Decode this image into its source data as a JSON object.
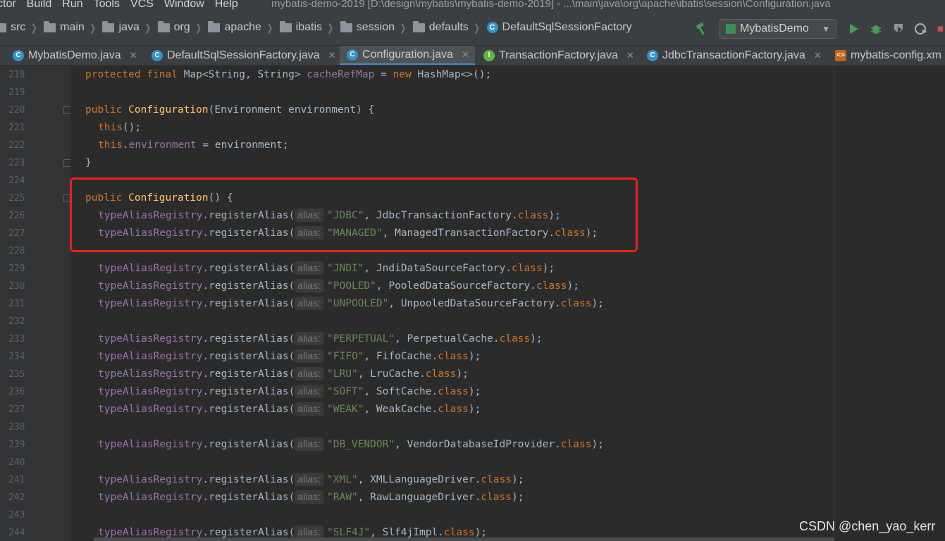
{
  "menu": {
    "items": [
      "ctor",
      "Build",
      "Run",
      "Tools",
      "VCS",
      "Window",
      "Help"
    ],
    "window_title": "mybatis-demo-2019 [D:\\design\\mybatis\\mybatis-demo-2019] - ...\\main\\java\\org\\apache\\ibatis\\session\\Configuration.java"
  },
  "breadcrumb": {
    "items": [
      "src",
      "main",
      "java",
      "org",
      "apache",
      "ibatis",
      "session",
      "defaults"
    ],
    "class_name": "DefaultSqlSessionFactory",
    "class_icon": "class-icon"
  },
  "toolbar": {
    "run_config": "MybatisDemo",
    "icons": [
      "hammer-icon",
      "run-icon",
      "debug-icon",
      "coverage-icon",
      "profile-icon",
      "stop-icon"
    ]
  },
  "tabs": [
    {
      "label": "MybatisDemo.java",
      "icon": "class-icon",
      "active": false
    },
    {
      "label": "DefaultSqlSessionFactory.java",
      "icon": "class-icon",
      "active": false
    },
    {
      "label": "Configuration.java",
      "icon": "class-icon",
      "active": true
    },
    {
      "label": "TransactionFactory.java",
      "icon": "interface-icon",
      "active": false
    },
    {
      "label": "JdbcTransactionFactory.java",
      "icon": "class-icon",
      "active": false
    },
    {
      "label": "mybatis-config.xm",
      "icon": "xml-icon",
      "active": false
    }
  ],
  "editor": {
    "line_numbers": [
      "218",
      "219",
      "220",
      "221",
      "222",
      "223",
      "224",
      "225",
      "226",
      "227",
      "228",
      "229",
      "230",
      "231",
      "232",
      "233",
      "234",
      "235",
      "236",
      "237",
      "238",
      "239",
      "240",
      "241",
      "242",
      "243",
      "244"
    ],
    "param_hint": "alias:",
    "lines": {
      "l218": [
        "protected",
        " ",
        "final",
        " Map<String, String> ",
        "cacheRefMap",
        " = ",
        "new",
        " HashMap<>();"
      ],
      "l220": [
        "public",
        " ",
        "Configuration",
        "(Environment environment) {"
      ],
      "l221": [
        "this",
        "();"
      ],
      "l222": [
        "this",
        ".",
        "environment",
        " = environment;"
      ],
      "l223": "}",
      "l225": [
        "public",
        " ",
        "Configuration",
        "() {"
      ]
    },
    "alias_calls": [
      {
        "line": "226",
        "target": "typeAliasRegistry",
        "method": ".registerAlias(",
        "alias": "\"JDBC\"",
        "cls": ", JdbcTransactionFactory.",
        "suffix": "class",
        "end": ");"
      },
      {
        "line": "227",
        "target": "typeAliasRegistry",
        "method": ".registerAlias(",
        "alias": "\"MANAGED\"",
        "cls": ", ManagedTransactionFactory.",
        "suffix": "class",
        "end": ");"
      },
      {
        "line": "229",
        "target": "typeAliasRegistry",
        "method": ".registerAlias(",
        "alias": "\"JNDI\"",
        "cls": ", JndiDataSourceFactory.",
        "suffix": "class",
        "end": ");"
      },
      {
        "line": "230",
        "target": "typeAliasRegistry",
        "method": ".registerAlias(",
        "alias": "\"POOLED\"",
        "cls": ", PooledDataSourceFactory.",
        "suffix": "class",
        "end": ");"
      },
      {
        "line": "231",
        "target": "typeAliasRegistry",
        "method": ".registerAlias(",
        "alias": "\"UNPOOLED\"",
        "cls": ", UnpooledDataSourceFactory.",
        "suffix": "class",
        "end": ");"
      },
      {
        "line": "233",
        "target": "typeAliasRegistry",
        "method": ".registerAlias(",
        "alias": "\"PERPETUAL\"",
        "cls": ", PerpetualCache.",
        "suffix": "class",
        "end": ");"
      },
      {
        "line": "234",
        "target": "typeAliasRegistry",
        "method": ".registerAlias(",
        "alias": "\"FIFO\"",
        "cls": ", FifoCache.",
        "suffix": "class",
        "end": ");"
      },
      {
        "line": "235",
        "target": "typeAliasRegistry",
        "method": ".registerAlias(",
        "alias": "\"LRU\"",
        "cls": ", LruCache.",
        "suffix": "class",
        "end": ");"
      },
      {
        "line": "236",
        "target": "typeAliasRegistry",
        "method": ".registerAlias(",
        "alias": "\"SOFT\"",
        "cls": ", SoftCache.",
        "suffix": "class",
        "end": ");"
      },
      {
        "line": "237",
        "target": "typeAliasRegistry",
        "method": ".registerAlias(",
        "alias": "\"WEAK\"",
        "cls": ", WeakCache.",
        "suffix": "class",
        "end": ");"
      },
      {
        "line": "239",
        "target": "typeAliasRegistry",
        "method": ".registerAlias(",
        "alias": "\"DB_VENDOR\"",
        "cls": ", VendorDatabaseIdProvider.",
        "suffix": "class",
        "end": ");"
      },
      {
        "line": "241",
        "target": "typeAliasRegistry",
        "method": ".registerAlias(",
        "alias": "\"XML\"",
        "cls": ", XMLLanguageDriver.",
        "suffix": "class",
        "end": ");"
      },
      {
        "line": "242",
        "target": "typeAliasRegistry",
        "method": ".registerAlias(",
        "alias": "\"RAW\"",
        "cls": ", RawLanguageDriver.",
        "suffix": "class",
        "end": ");"
      },
      {
        "line": "244",
        "target": "typeAliasRegistry",
        "method": ".registerAlias(",
        "alias": "\"SLF4J\"",
        "cls": ", Slf4jImpl.",
        "suffix": "class",
        "end": ");"
      }
    ]
  },
  "colors": {
    "keyword": "#cc7832",
    "method_decl": "#ffc66d",
    "field": "#9876aa",
    "string": "#6a8759",
    "identifier": "#a9b7c6",
    "highlight_box": "#e8211c"
  },
  "watermark": "CSDN @chen_yao_kerr"
}
